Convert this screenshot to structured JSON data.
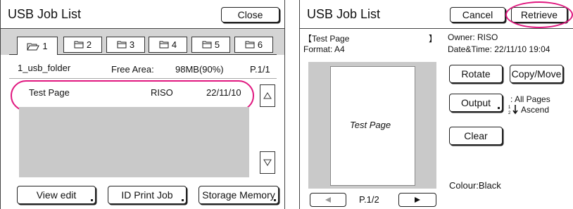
{
  "left": {
    "title": "USB Job List",
    "close_label": "Close",
    "tabs": [
      "1",
      "2",
      "3",
      "4",
      "5",
      "6"
    ],
    "folder_name": "1_usb_folder",
    "free_area_label": "Free Area:",
    "free_area_value": "98MB(90%)",
    "page_indicator": "P.1/1",
    "job": {
      "name": "Test Page",
      "owner": "RISO",
      "date": "22/11/10"
    },
    "buttons": {
      "view_edit": "View edit",
      "id_print": "ID Print Job",
      "storage": "Storage Memory"
    }
  },
  "right": {
    "title": "USB Job List",
    "cancel_label": "Cancel",
    "retrieve_label": "Retrieve",
    "doc_bracket_open": "【Test Page",
    "doc_bracket_close": "】",
    "format": "Format: A4",
    "owner": "Owner: RISO",
    "datetime": "Date&Time: 22/11/10  19:04",
    "preview_text": "Test Page",
    "rotate_label": "Rotate",
    "copy_move_label": "Copy/Move",
    "output_label": "Output",
    "output_pages": ": All Pages",
    "output_order": "Ascend",
    "clear_label": "Clear",
    "colour": "Colour:Black",
    "page_indicator": "P.1/2"
  },
  "colors": {
    "highlight": "#e0177f",
    "gray": "#c9c9c9"
  }
}
